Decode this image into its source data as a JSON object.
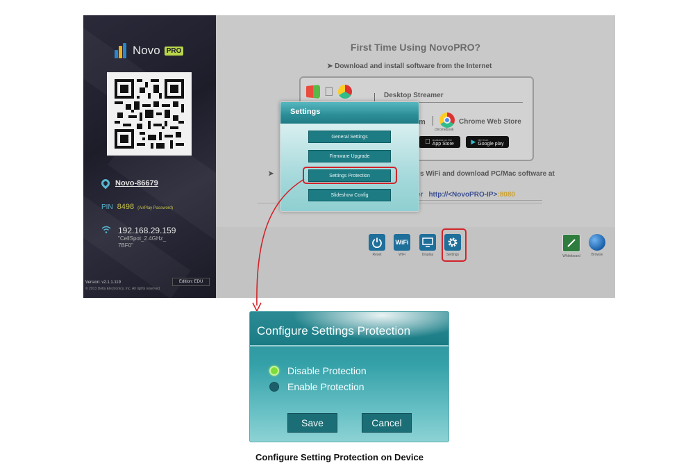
{
  "device_screen": {
    "logo": {
      "name": "Novo",
      "badge": "PRO"
    },
    "device_name": "Novo-86679",
    "pin": {
      "label": "PIN",
      "value": "8498",
      "note": "(AirPlay Password)"
    },
    "network": {
      "ip": "192.168.29.159",
      "ssid": "\"CellSpot_2.4GHz_\n7BF0\""
    },
    "version": "Version: v2.1.1.119",
    "copyright": "© 2013 Delta Electronics, Inc. All rights reserved",
    "edition": "Edition: EDU",
    "main": {
      "title": "First Time Using NovoPRO?",
      "step1": "➤ Download and install software from the Internet",
      "desktop_streamer": "Desktop Streamer",
      "m_partial": "m",
      "chromebook": "chromebook",
      "chrome_web_store": "Chrome Web Store",
      "app_store": {
        "small": "Available on the",
        "label": "App Store"
      },
      "google_play": {
        "small": "Get it on",
        "label": "Google play"
      },
      "step2_arrow": "➤",
      "step2_text": "s WiFi and download PC/Mac software at",
      "url_label": "er",
      "url": "http://<NovoPRO-IP>",
      "url_port": ":8080"
    },
    "toolbar": [
      {
        "label": "Reset",
        "icon": "power-icon",
        "color": "#1f6f9b"
      },
      {
        "label": "WiFi",
        "icon": "wifi-icon",
        "color": "#1f6f9b"
      },
      {
        "label": "Display",
        "icon": "display-icon",
        "color": "#1f6f9b"
      },
      {
        "label": "Settings",
        "icon": "gear-icon",
        "color": "#1f6f9b"
      },
      {
        "label": "Whiteboard",
        "icon": "whiteboard-icon",
        "color": "#2f7d3e"
      },
      {
        "label": "Browse",
        "icon": "globe-icon",
        "color": "#1b5fa8"
      }
    ],
    "settings_popup": {
      "title": "Settings",
      "buttons": [
        "General Settings",
        "Firmware Upgrade",
        "Settings Protection",
        "Slideshow Config"
      ]
    }
  },
  "dialog": {
    "title": "Configure Settings Protection",
    "options": [
      {
        "label": "Disable Protection",
        "selected": true
      },
      {
        "label": "Enable Protection",
        "selected": false
      }
    ],
    "save": "Save",
    "cancel": "Cancel"
  },
  "caption": "Configure Setting Protection on Device",
  "colors": {
    "highlight": "#d2232a",
    "teal": "#1c7b83"
  }
}
